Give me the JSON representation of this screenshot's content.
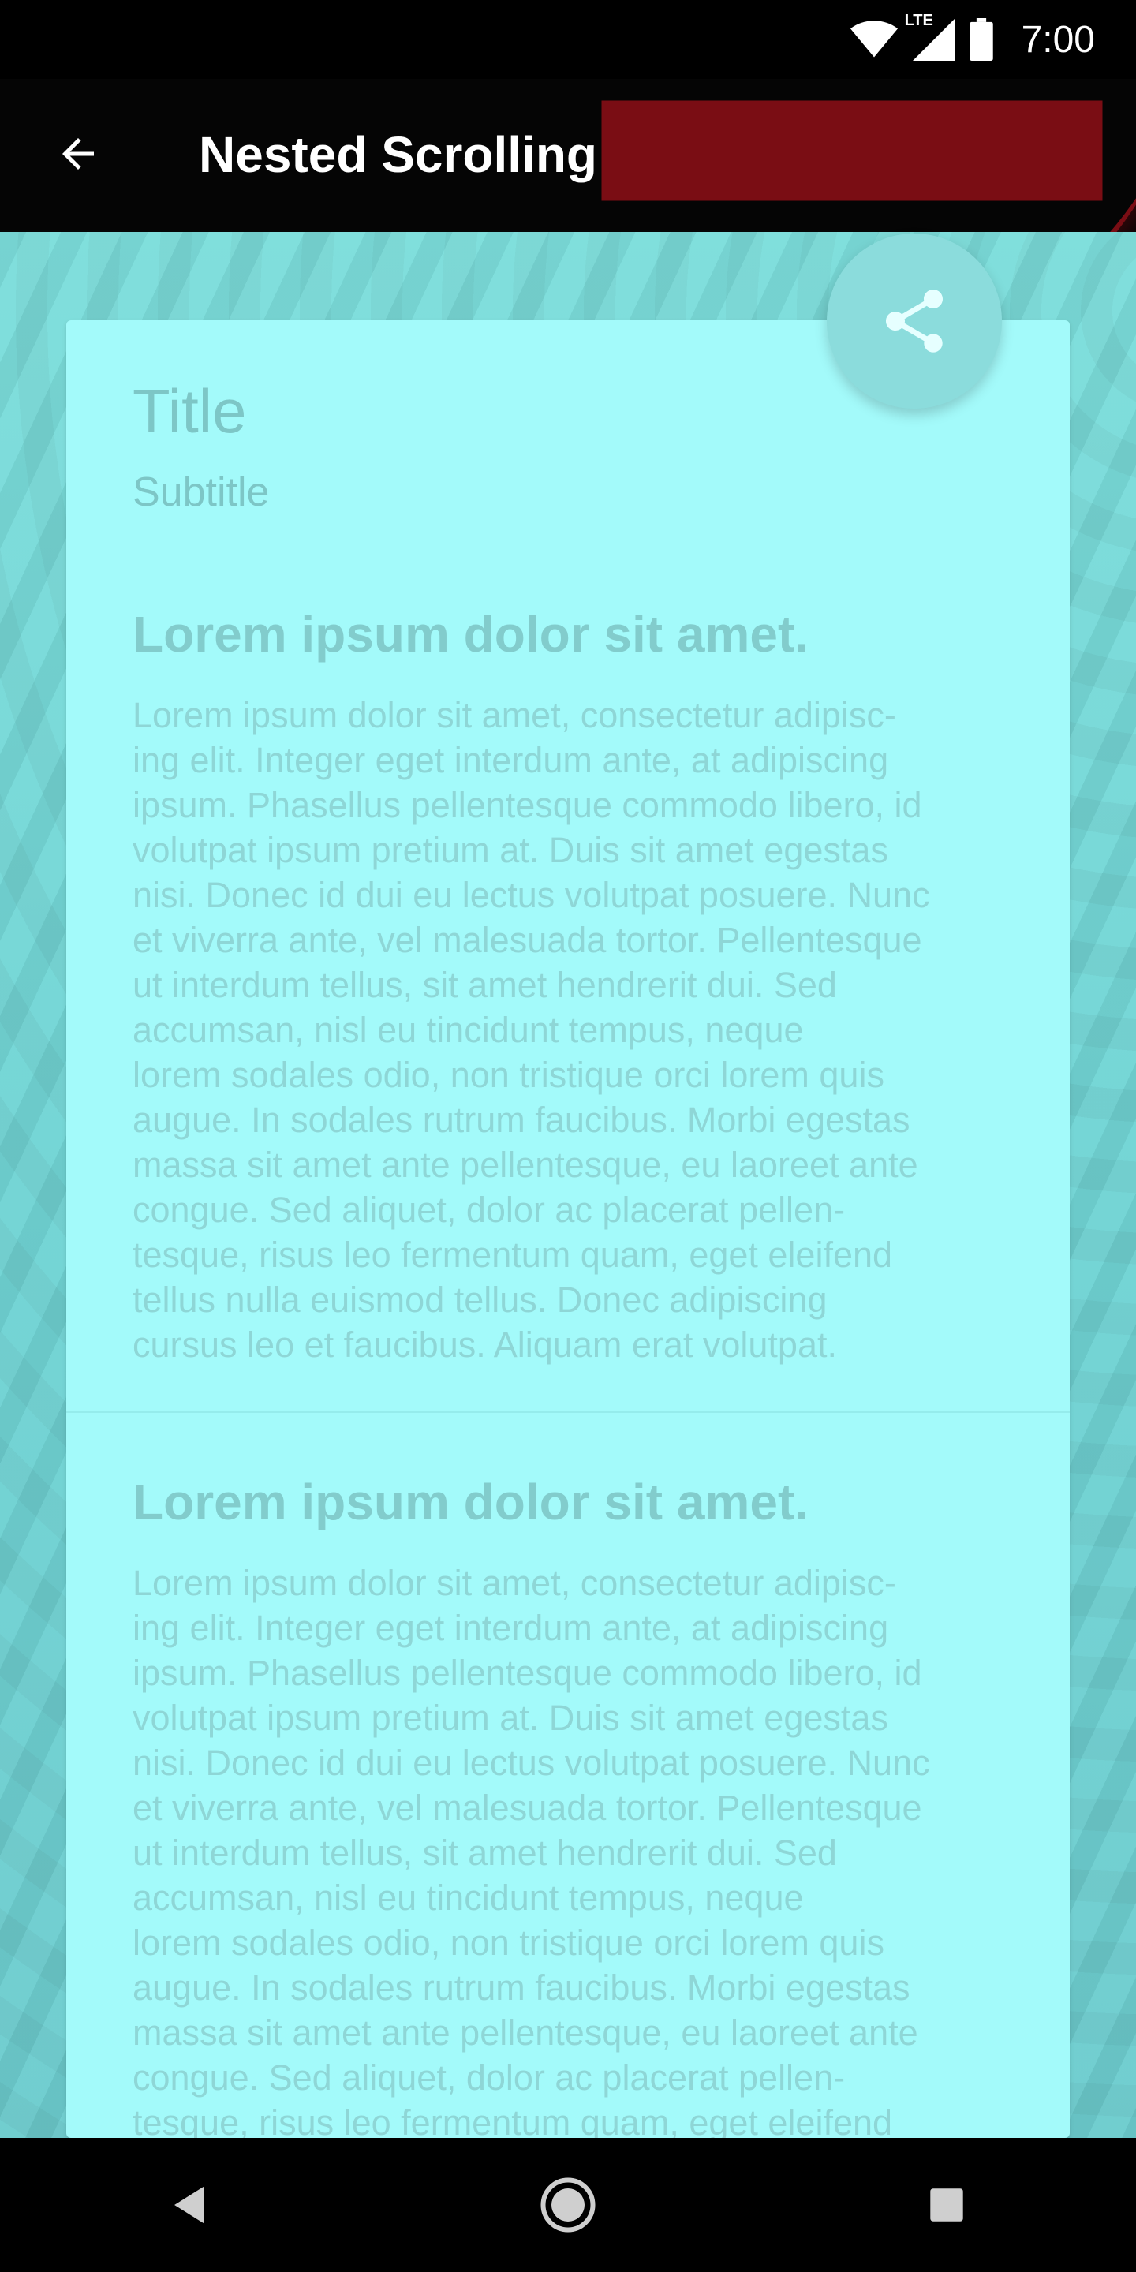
{
  "status_bar": {
    "time": "7:00",
    "network_label": "LTE",
    "icons": [
      "wifi-icon",
      "lte-signal-icon",
      "battery-icon"
    ]
  },
  "app_bar": {
    "title": "Nested Scrolling",
    "back_icon": "arrow-back-icon"
  },
  "fab": {
    "icon": "share-icon"
  },
  "card": {
    "title": "Title",
    "subtitle": "Subtitle",
    "sections": [
      {
        "heading": "Lorem ipsum dolor sit amet.",
        "body": "Lorem ipsum dolor sit amet, consectetur adipisc-\ning elit. Integer eget interdum ante, at adipiscing\nipsum. Phasellus pellentesque commodo libero, id\nvolutpat ipsum pretium at. Duis sit amet egestas\nnisi. Donec id dui eu lectus volutpat posuere. Nunc\net viverra ante, vel malesuada tortor. Pellentesque\nut interdum tellus, sit amet hendrerit dui. Sed\naccumsan, nisl eu tincidunt tempus, neque\nlorem sodales odio, non tristique orci lorem quis\naugue. In sodales rutrum faucibus. Morbi egestas\nmassa sit amet ante pellentesque, eu laoreet ante\ncongue. Sed aliquet, dolor ac placerat pellen-\ntesque, risus leo fermentum quam, eget eleifend\ntellus nulla euismod tellus. Donec adipiscing\ncursus leo et faucibus. Aliquam erat volutpat."
      },
      {
        "heading": "Lorem ipsum dolor sit amet.",
        "body": "Lorem ipsum dolor sit amet, consectetur adipisc-\ning elit. Integer eget interdum ante, at adipiscing\nipsum. Phasellus pellentesque commodo libero, id\nvolutpat ipsum pretium at. Duis sit amet egestas\nnisi. Donec id dui eu lectus volutpat posuere. Nunc\net viverra ante, vel malesuada tortor. Pellentesque\nut interdum tellus, sit amet hendrerit dui. Sed\naccumsan, nisl eu tincidunt tempus, neque\nlorem sodales odio, non tristique orci lorem quis\naugue. In sodales rutrum faucibus. Morbi egestas\nmassa sit amet ante pellentesque, eu laoreet ante\ncongue. Sed aliquet, dolor ac placerat pellen-\ntesque, risus leo fermentum quam, eget eleifend"
      }
    ]
  },
  "nav_bar": {
    "icons": [
      "nav-back-icon",
      "nav-home-icon",
      "nav-recents-icon"
    ]
  },
  "colors": {
    "card_background": "#a3fafa",
    "fab_background": "#8bdcdc",
    "text_muted": "#7dc6c6",
    "app_bar_background": "#050505"
  }
}
